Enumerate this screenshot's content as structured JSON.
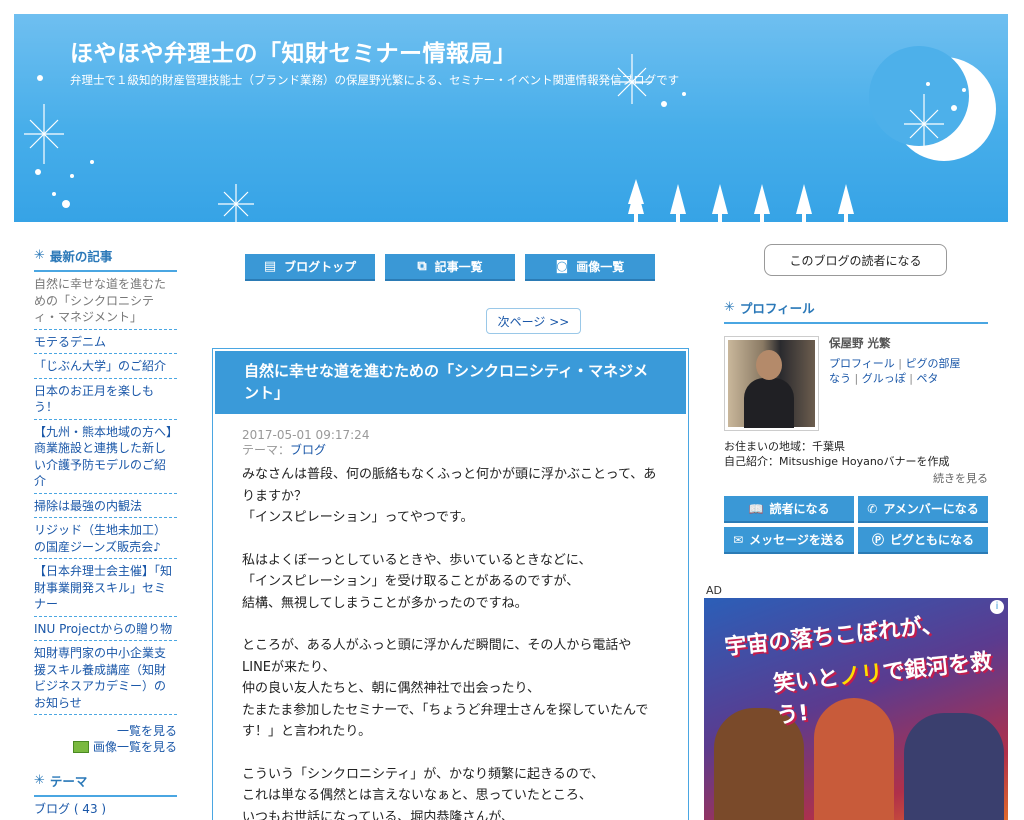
{
  "header": {
    "title": "ほやほや弁理士の「知財セミナー情報局」",
    "subtitle": "弁理士で１級知的財産管理技能士（ブランド業務）の保屋野光繁による、セミナー・イベント関連情報発信ブログです"
  },
  "left": {
    "recent_title": "最新の記事",
    "recent_items": [
      "自然に幸せな道を進むための「シンクロニシティ・マネジメント」",
      "モテるデニム",
      "「じぶん大学」のご紹介",
      "日本のお正月を楽しもう！",
      "【九州・熊本地域の方へ】商業施設と連携した新しい介護予防モデルのご紹介",
      "掃除は最強の内観法",
      "リジッド（生地未加工）の国産ジーンズ販売会♪",
      "【日本弁理士会主催】「知財事業開発スキル」セミナー",
      "INU Projectからの贈り物",
      "知財専門家の中小企業支援スキル養成講座（知財ビジネスアカデミー）のお知らせ"
    ],
    "list_more": "一覧を見る",
    "image_list_more": "画像一覧を見る",
    "theme_title": "テーマ",
    "theme_items": [
      "ブログ ( 43 )"
    ]
  },
  "nav": {
    "blog_top": "ブログトップ",
    "article_list": "記事一覧",
    "image_list": "画像一覧",
    "next_page": "次ページ >>"
  },
  "article": {
    "title": "自然に幸せな道を進むための「シンクロニシティ・マネジメント」",
    "date": "2017-05-01 09:17:24",
    "theme_label": "テーマ：",
    "theme_link": "ブログ",
    "paragraphs": [
      [
        "みなさんは普段、何の脈絡もなくふっと何かが頭に浮かぶことって、ありますか？",
        "「インスピレーション」ってやつです。"
      ],
      [
        "私はよくぼーっとしているときや、歩いているときなどに、",
        "「インスピレーション」を受け取ることがあるのですが、",
        "結構、無視してしまうことが多かったのですね。"
      ],
      [
        "ところが、ある人がふっと頭に浮かんだ瞬間に、その人から電話やLINEが来たり、",
        "仲の良い友人たちと、朝に偶然神社で出会ったり、",
        "たまたま参加したセミナーで、「ちょうど弁理士さんを探していたんです！」と言われたり。"
      ],
      [
        "こういう「シンクロニシティ」が、かなり頻繁に起きるので、",
        "これは単なる偶然とは言えないなぁと、思っていたところ、",
        "いつもお世話になっている、堀内恭隆さんが、"
      ]
    ]
  },
  "right": {
    "reader_button": "このブログの読者になる",
    "profile_title": "プロフィール",
    "name": "保屋野 光繁",
    "profile_link": "プロフィール",
    "sep": "|",
    "room_link": "ピグの部屋",
    "now_link": "なう",
    "gurupo_link": "グルっぽ",
    "peta_link": "ペタ",
    "address": "お住まいの地域：千葉県",
    "intro": "自己紹介：Mitsushige Hoyanoバナーを作成",
    "more": "続きを見る",
    "actions": [
      "読者になる",
      "アメンバーになる",
      "メッセージを送る",
      "ピグともになる"
    ],
    "ad_label": "AD",
    "ad_line1": "宇宙の落ちこぼれが、",
    "ad_line2_a": "笑いと",
    "ad_line2_b": "ノリ",
    "ad_line2_c": "で銀河を救う!"
  }
}
